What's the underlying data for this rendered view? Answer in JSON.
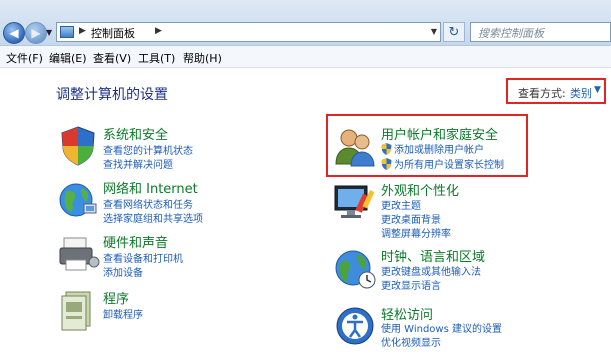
{
  "address_bar": {
    "breadcrumb": "控制面板",
    "search_placeholder": "搜索控制面板"
  },
  "menu": [
    "文件(F)",
    "编辑(E)",
    "查看(V)",
    "工具(T)",
    "帮助(H)"
  ],
  "page_title": "调整计算机的设置",
  "view": {
    "label": "查看方式:",
    "value": "类别"
  },
  "categories": [
    {
      "title": "系统和安全",
      "links": [
        "查看您的计算机状态",
        "查找并解决问题"
      ]
    },
    {
      "title": "网络和 Internet",
      "links": [
        "查看网络状态和任务",
        "选择家庭组和共享选项"
      ]
    },
    {
      "title": "硬件和声音",
      "links": [
        "查看设备和打印机",
        "添加设备"
      ]
    },
    {
      "title": "程序",
      "links": [
        "卸载程序"
      ]
    },
    {
      "title": "用户帐户和家庭安全",
      "links": [
        "添加或删除用户帐户",
        "为所有用户设置家长控制"
      ]
    },
    {
      "title": "外观和个性化",
      "links": [
        "更改主题",
        "更改桌面背景",
        "调整屏幕分辨率"
      ]
    },
    {
      "title": "时钟、语言和区域",
      "links": [
        "更改键盘或其他输入法",
        "更改显示语言"
      ]
    },
    {
      "title": "轻松访问",
      "links": [
        "使用 Windows 建议的设置",
        "优化视频显示"
      ]
    }
  ]
}
